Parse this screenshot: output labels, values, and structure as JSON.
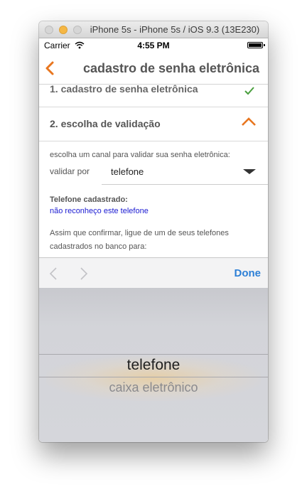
{
  "window": {
    "title": "iPhone 5s - iPhone 5s / iOS 9.3 (13E230)"
  },
  "status_bar": {
    "carrier": "Carrier",
    "time": "4:55 PM"
  },
  "nav": {
    "title": "cadastro de senha eletrônica",
    "back_icon": "chevron-left-icon",
    "accent_color": "#e8761f"
  },
  "steps": [
    {
      "label": "1. cadastro de senha eletrônica",
      "status_icon": "check-icon",
      "status_color": "#4a9f3e"
    },
    {
      "label": "2. escolha de validação",
      "status_icon": "chevron-up-icon",
      "status_color": "#e8761f"
    }
  ],
  "validation": {
    "instruction": "escolha um canal para validar sua senha eletrônica:",
    "validate_label": "validar por",
    "selected_value": "telefone"
  },
  "phone": {
    "heading": "Telefone cadastrado:",
    "link": "não reconheço este telefone"
  },
  "info": {
    "line1": "Assim que confirmar, ligue de um de seus telefones",
    "line2": "cadastrados no banco para:"
  },
  "toolbar": {
    "done_label": "Done",
    "done_color": "#2c7fd6"
  },
  "picker": {
    "selected": "telefone",
    "options": [
      "telefone",
      "caixa eletrônico"
    ]
  }
}
